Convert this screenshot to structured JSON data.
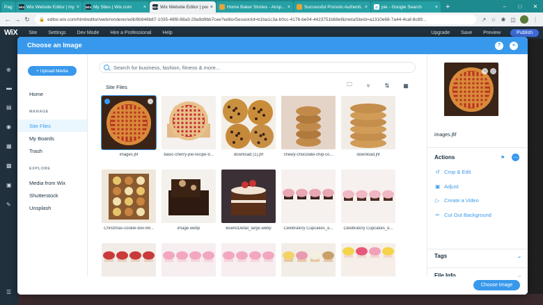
{
  "browser": {
    "tabs": [
      {
        "label": "Pag",
        "icon": "",
        "active": false,
        "color": "#25a0a4"
      },
      {
        "label": "Wix Website Editor | my-w...",
        "icon": "WiX",
        "active": false,
        "color": "#ffffff"
      },
      {
        "label": "My Sites | Wix.com",
        "icon": "WiX",
        "active": false,
        "color": "#ffffff"
      },
      {
        "label": "Wix Website Editor | poob...",
        "icon": "WiX",
        "active": true,
        "color": "#ffffff"
      },
      {
        "label": "Home Baker Stories - Ansp...",
        "icon": "",
        "active": false,
        "color": "#ffffff"
      },
      {
        "label": "Successful Pronoto Authenti...",
        "icon": "",
        "active": false,
        "color": "#ffffff"
      },
      {
        "label": "pie - Google Search",
        "icon": "G",
        "active": false,
        "color": "#ffffff"
      }
    ],
    "new_tab": "+",
    "url": "editor.wix.com/html/editor/web/renderer/edit/8b946b87-1035-48f8-88a3-29a9d9bb7cee?editorSessionId=b1ba1c3a-b0cc-4176-be04-4423751b68ef&metaSiteId=a1310e68-7a44-4caf-8c89..."
  },
  "wix_header": {
    "logo": "WiX",
    "menu": [
      "Site",
      "Settings",
      "Dev Mode",
      "Hire a Professional",
      "Help"
    ],
    "right": [
      "Upgrade",
      "Save",
      "Preview"
    ],
    "publish": "Publish"
  },
  "modal": {
    "title": "Choose an Image",
    "help_label": "?",
    "close_label": "×",
    "upload_button": "+ Upload Media",
    "home": "Home",
    "manage_heading": "MANAGE",
    "manage_items": [
      "Site Files",
      "My Boards",
      "Trash"
    ],
    "explore_heading": "EXPLORE",
    "explore_items": [
      "Media from Wix",
      "Shutterstock",
      "Unsplash"
    ],
    "search_placeholder": "Search for business, fashion, fitness & more...",
    "section_title": "Site Files",
    "choose_button": "Choose Image"
  },
  "files": [
    {
      "caption": "images.jfif",
      "selected": true,
      "kind": "pie"
    },
    {
      "caption": "basic-cherry-pie-recipe-9...",
      "selected": false,
      "kind": "cherrypie"
    },
    {
      "caption": "download (1).jfif",
      "selected": false,
      "kind": "cookies"
    },
    {
      "caption": "chewy-chocolate-chip-co...",
      "selected": false,
      "kind": "cookiestack"
    },
    {
      "caption": "download.jfif",
      "selected": false,
      "kind": "cookiestack2"
    },
    {
      "caption": "Christmas-cookie-box-68...",
      "selected": false,
      "kind": "cookiebox"
    },
    {
      "caption": "image.webp",
      "selected": false,
      "kind": "brownie"
    },
    {
      "caption": "BuenoDetail_large.webp",
      "selected": false,
      "kind": "cake"
    },
    {
      "caption": "Celebratory Cupcakes_e...",
      "selected": false,
      "kind": "cupcakes"
    },
    {
      "caption": "Celebratory Cupcakes_e...",
      "selected": false,
      "kind": "cupcakes2"
    },
    {
      "caption": "",
      "selected": false,
      "kind": "cupcakesred"
    },
    {
      "caption": "",
      "selected": false,
      "kind": "cupcakespink"
    },
    {
      "caption": "",
      "selected": false,
      "kind": "cupcakespink"
    },
    {
      "caption": "",
      "selected": false,
      "kind": "cupcakesmixed"
    },
    {
      "caption": "",
      "selected": false,
      "kind": "cupcakesyellow"
    }
  ],
  "details": {
    "filename": "images.jfif",
    "actions_title": "Actions",
    "actions": [
      {
        "label": "Crop & Edit",
        "icon": "crop-icon"
      },
      {
        "label": "Adjust",
        "icon": "adjust-icon"
      },
      {
        "label": "Create a Video",
        "icon": "video-icon"
      },
      {
        "label": "Cut Out Background",
        "icon": "cutout-icon"
      }
    ],
    "tags": "Tags",
    "file_info": "File Info"
  },
  "colors": {
    "accent": "#3899ec",
    "header": "#20303c",
    "tabbar": "#1c8a8e"
  }
}
